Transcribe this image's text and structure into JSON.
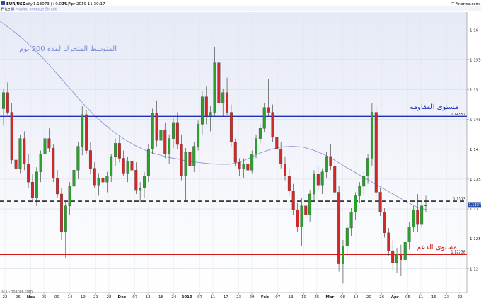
{
  "header": {
    "symbol": "EUR/USD",
    "timeframe": "Daily",
    "price_change": "1.13073 (+0.02%)",
    "datetime": "16-Apr-2019 11:39:17",
    "brand": "IT-Finance.com",
    "legend_price": "Price",
    "legend_ma": "Moving average Simple"
  },
  "footer": {
    "brand": "© IT-Finance.com"
  },
  "colors": {
    "background_top": "#e8ecf7",
    "background_bottom": "#ffffff",
    "bull": "#2ca02c",
    "bear": "#d62728",
    "ma": "#8c96d6",
    "resistance": "#1f2fbf",
    "support": "#d21a1a",
    "current": "#000000"
  },
  "chart_data": {
    "type": "candlestick",
    "ylim": [
      1.116,
      1.163
    ],
    "y_ticks": [
      1.12,
      1.125,
      1.13,
      1.135,
      1.14,
      1.145,
      1.15,
      1.155,
      1.16
    ],
    "y_tick_labels": [
      "1.12",
      "1.125",
      "1.13",
      "1.135",
      "1.14",
      "1.145",
      "1.15",
      "1.155",
      "1.16"
    ],
    "x_labels": [
      "22",
      "26",
      "Nov",
      "05",
      "09",
      "14",
      "19",
      "23",
      "28",
      "Dec",
      "07",
      "12",
      "18",
      "24",
      "2019",
      "07",
      "11",
      "17",
      "23",
      "29",
      "Feb",
      "07",
      "13",
      "19",
      "25",
      "Mar",
      "08",
      "14",
      "20",
      "26",
      "Apr",
      "05",
      "11",
      "15",
      "23",
      "29"
    ],
    "x_label_bold": [
      "Nov",
      "Dec",
      "2019",
      "Feb",
      "Mar",
      "Apr"
    ],
    "annotations": {
      "ma_label": "المتوسط المتحرك لمدة 200 يوم",
      "resistance_label": "مستوى المقاومة",
      "support_label": "مستوى الدعم"
    },
    "levels": {
      "resistance": {
        "value": 1.14552,
        "label": "1.14552"
      },
      "current": {
        "value": 1.1313,
        "label": "1.1313"
      },
      "support": {
        "value": 1.12238,
        "label": "1.12238"
      },
      "last_price": {
        "value": 1.13073,
        "label": "1.13073"
      }
    },
    "ma": [
      1.1615,
      1.1602,
      1.1588,
      1.1572,
      1.1555,
      1.1536,
      1.1516,
      1.1496,
      1.1476,
      1.1458,
      1.1442,
      1.1428,
      1.1416,
      1.1406,
      1.1398,
      1.1392,
      1.1387,
      1.1384,
      1.138,
      1.1378,
      1.1376,
      1.1375,
      1.1375,
      1.1378,
      1.1386,
      1.1394,
      1.14,
      1.1404,
      1.1405,
      1.1404,
      1.1399,
      1.1392,
      1.1383,
      1.1372,
      1.1362,
      1.1352,
      1.1342,
      1.1332,
      1.1322,
      1.1312,
      1.1303,
      1.1298
    ],
    "candles": [
      [
        1.1468,
        1.1502,
        1.144,
        1.1495
      ],
      [
        1.1495,
        1.1512,
        1.1458,
        1.1462
      ],
      [
        1.1462,
        1.1478,
        1.1375,
        1.1382
      ],
      [
        1.1382,
        1.1395,
        1.1352,
        1.1368
      ],
      [
        1.1368,
        1.1425,
        1.136,
        1.1418
      ],
      [
        1.1418,
        1.143,
        1.1365,
        1.1375
      ],
      [
        1.1375,
        1.1392,
        1.1335,
        1.1345
      ],
      [
        1.1345,
        1.1358,
        1.1315,
        1.1318
      ],
      [
        1.1318,
        1.137,
        1.1305,
        1.1362
      ],
      [
        1.1362,
        1.1398,
        1.1345,
        1.1392
      ],
      [
        1.1392,
        1.1425,
        1.138,
        1.1418
      ],
      [
        1.1418,
        1.1435,
        1.1395,
        1.1402
      ],
      [
        1.1402,
        1.1408,
        1.1345,
        1.1352
      ],
      [
        1.1352,
        1.1365,
        1.1318,
        1.1325
      ],
      [
        1.1325,
        1.1335,
        1.1248,
        1.1262
      ],
      [
        1.1262,
        1.1312,
        1.1218,
        1.1305
      ],
      [
        1.1305,
        1.1345,
        1.129,
        1.1338
      ],
      [
        1.1338,
        1.1372,
        1.1322,
        1.1365
      ],
      [
        1.1365,
        1.1412,
        1.135,
        1.1405
      ],
      [
        1.1405,
        1.1472,
        1.139,
        1.1458
      ],
      [
        1.1458,
        1.1466,
        1.1392,
        1.1398
      ],
      [
        1.1398,
        1.1412,
        1.1358,
        1.1368
      ],
      [
        1.1368,
        1.1378,
        1.1335,
        1.134
      ],
      [
        1.134,
        1.136,
        1.1322,
        1.1352
      ],
      [
        1.1352,
        1.1372,
        1.134,
        1.1345
      ],
      [
        1.1345,
        1.1362,
        1.1328,
        1.1355
      ],
      [
        1.1355,
        1.1392,
        1.1345,
        1.1388
      ],
      [
        1.1388,
        1.1418,
        1.1372,
        1.141
      ],
      [
        1.141,
        1.1422,
        1.1378,
        1.1385
      ],
      [
        1.1385,
        1.1398,
        1.1355,
        1.136
      ],
      [
        1.136,
        1.1388,
        1.1345,
        1.138
      ],
      [
        1.138,
        1.1398,
        1.1358,
        1.1365
      ],
      [
        1.1365,
        1.1378,
        1.1325,
        1.1332
      ],
      [
        1.1332,
        1.1345,
        1.1312,
        1.1335
      ],
      [
        1.1335,
        1.1362,
        1.1318,
        1.1355
      ],
      [
        1.1355,
        1.1408,
        1.1345,
        1.14
      ],
      [
        1.14,
        1.1468,
        1.1392,
        1.146
      ],
      [
        1.146,
        1.1482,
        1.1405,
        1.1415
      ],
      [
        1.1415,
        1.1442,
        1.139,
        1.1432
      ],
      [
        1.1432,
        1.1445,
        1.1385,
        1.1392
      ],
      [
        1.1392,
        1.1425,
        1.1375,
        1.1418
      ],
      [
        1.1418,
        1.1452,
        1.1402,
        1.1445
      ],
      [
        1.1445,
        1.1462,
        1.14,
        1.1408
      ],
      [
        1.1408,
        1.1425,
        1.1348,
        1.1355
      ],
      [
        1.1355,
        1.1402,
        1.1312,
        1.1395
      ],
      [
        1.1395,
        1.1405,
        1.1365,
        1.1372
      ],
      [
        1.1372,
        1.1412,
        1.1362,
        1.1405
      ],
      [
        1.1405,
        1.1448,
        1.1398,
        1.1442
      ],
      [
        1.1442,
        1.1498,
        1.1425,
        1.1488
      ],
      [
        1.1488,
        1.1505,
        1.1442,
        1.1455
      ],
      [
        1.1455,
        1.1472,
        1.143,
        1.1462
      ],
      [
        1.1462,
        1.1572,
        1.1455,
        1.1545
      ],
      [
        1.1545,
        1.1568,
        1.147,
        1.1478
      ],
      [
        1.1478,
        1.1502,
        1.1455,
        1.1495
      ],
      [
        1.1495,
        1.152,
        1.1458,
        1.1462
      ],
      [
        1.1462,
        1.1475,
        1.1405,
        1.1412
      ],
      [
        1.1412,
        1.1418,
        1.1372,
        1.1378
      ],
      [
        1.1378,
        1.1385,
        1.1355,
        1.1368
      ],
      [
        1.1368,
        1.1385,
        1.1352,
        1.1375
      ],
      [
        1.1375,
        1.1392,
        1.1358,
        1.1365
      ],
      [
        1.1365,
        1.1398,
        1.136,
        1.1392
      ],
      [
        1.1392,
        1.1425,
        1.1385,
        1.1418
      ],
      [
        1.1418,
        1.1442,
        1.141,
        1.1435
      ],
      [
        1.1435,
        1.1478,
        1.1428,
        1.147
      ],
      [
        1.147,
        1.1518,
        1.1455,
        1.1462
      ],
      [
        1.1462,
        1.1475,
        1.1412,
        1.142
      ],
      [
        1.142,
        1.1432,
        1.1392,
        1.14
      ],
      [
        1.14,
        1.1412,
        1.1368,
        1.1375
      ],
      [
        1.1375,
        1.1388,
        1.1348,
        1.1355
      ],
      [
        1.1355,
        1.1368,
        1.1322,
        1.133
      ],
      [
        1.133,
        1.1342,
        1.129,
        1.1298
      ],
      [
        1.1298,
        1.131,
        1.1262,
        1.127
      ],
      [
        1.127,
        1.1318,
        1.1238,
        1.1305
      ],
      [
        1.1305,
        1.1325,
        1.1282,
        1.129
      ],
      [
        1.129,
        1.1332,
        1.1278,
        1.1325
      ],
      [
        1.1325,
        1.1365,
        1.1312,
        1.1358
      ],
      [
        1.1358,
        1.1372,
        1.1332,
        1.134
      ],
      [
        1.134,
        1.1368,
        1.1325,
        1.1362
      ],
      [
        1.1362,
        1.1395,
        1.1352,
        1.1388
      ],
      [
        1.1388,
        1.1408,
        1.1365,
        1.1372
      ],
      [
        1.1372,
        1.1385,
        1.1322,
        1.1328
      ],
      [
        1.1328,
        1.1338,
        1.1195,
        1.1208
      ],
      [
        1.1208,
        1.1248,
        1.1175,
        1.1238
      ],
      [
        1.1238,
        1.1275,
        1.1225,
        1.1268
      ],
      [
        1.1268,
        1.1302,
        1.1255,
        1.1295
      ],
      [
        1.1295,
        1.1328,
        1.1282,
        1.1322
      ],
      [
        1.1322,
        1.1345,
        1.131,
        1.1338
      ],
      [
        1.1338,
        1.1362,
        1.1322,
        1.1355
      ],
      [
        1.1355,
        1.1392,
        1.1342,
        1.1385
      ],
      [
        1.1385,
        1.1478,
        1.1372,
        1.1462
      ],
      [
        1.1462,
        1.1472,
        1.1318,
        1.1328
      ],
      [
        1.1328,
        1.1335,
        1.1288,
        1.1295
      ],
      [
        1.1295,
        1.1302,
        1.1252,
        1.126
      ],
      [
        1.126,
        1.1268,
        1.1222,
        1.123
      ],
      [
        1.123,
        1.1248,
        1.1198,
        1.121
      ],
      [
        1.121,
        1.1235,
        1.1192,
        1.1225
      ],
      [
        1.1225,
        1.124,
        1.1188,
        1.1215
      ],
      [
        1.1215,
        1.1252,
        1.1205,
        1.1245
      ],
      [
        1.1245,
        1.1278,
        1.1232,
        1.127
      ],
      [
        1.127,
        1.1305,
        1.1262,
        1.1298
      ],
      [
        1.1298,
        1.1325,
        1.1262,
        1.1275
      ],
      [
        1.1275,
        1.1312,
        1.1268,
        1.1305
      ],
      [
        1.1305,
        1.1322,
        1.1295,
        1.1307
      ]
    ]
  }
}
